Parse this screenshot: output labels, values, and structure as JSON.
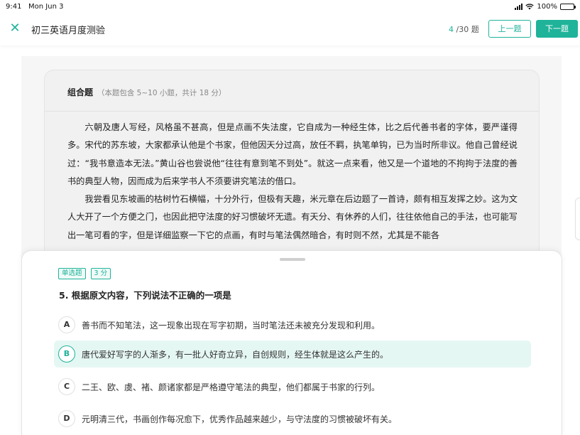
{
  "status_bar": {
    "time": "9:41",
    "date": "Mon Jun 3",
    "battery": "100%"
  },
  "header": {
    "close_icon": "close-icon",
    "title": "初三英语月度测验",
    "progress_current": "4",
    "progress_total": "/30 题",
    "prev_label": "上一题",
    "next_label": "下一题"
  },
  "passage": {
    "type_label": "组合题",
    "meta": "（本题包含 5~10 小题，共计 18 分）",
    "paragraphs": [
      "六朝及唐人写经，风格虽不甚高，但是点画不失法度，它自成为一种经生体，比之后代善书者的字体，要严谨得多。宋代的苏东坡，大家都承认他是个书家，但他因天分过高，放任不羁，执笔单钩，已为当时所非议。他自己曾经说过：“我书意造本无法。”黄山谷也尝说他“往往有意到笔不到处”。就这一点来看，他又是一个道地的不拘拘于法度的善书的典型人物，因而成为后来学书人不须要讲究笔法的借口。",
      "我尝看见东坡画的枯树竹石横幅，十分外行，但极有天趣，米元章在后边题了一首诗，颇有相互发挥之妙。这为文人大开了一个方便之门，也因此把守法度的好习惯破坏无遗。有天分、有休养的人们，往往依他自己的手法，也可能写出一笔可看的字，但是详细监察一下它的点画，有时与笔法偶然暗合，有时则不然，尤其是不能各"
    ]
  },
  "question": {
    "tags": [
      "单选题",
      "3 分"
    ],
    "text": "5. 根据原文内容，下列说法不正确的一项是",
    "options": [
      {
        "letter": "A",
        "text": "善书而不知笔法，这一现象出现在写字初期，当时笔法还未被充分发现和利用。"
      },
      {
        "letter": "B",
        "text": "唐代爱好写字的人渐多，有一批人好奇立异，自创规则，经生体就是这么产生的。",
        "selected": true
      },
      {
        "letter": "C",
        "text": "二王、欧、虞、褚、颜诸家都是严格遵守笔法的典型，他们都属于书家的行列。"
      },
      {
        "letter": "D",
        "text": "元明清三代，书画创作每况愈下，优秀作品越来越少，与守法度的习惯被破坏有关。"
      }
    ]
  },
  "colors": {
    "accent": "#1fb39a",
    "selected_bg": "#e5f7f3"
  }
}
